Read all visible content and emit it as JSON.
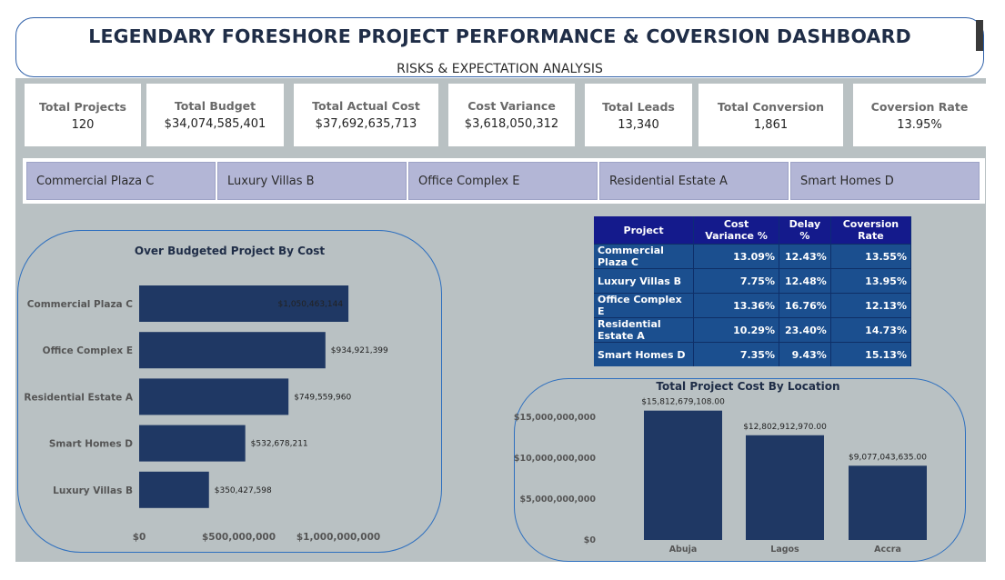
{
  "header": {
    "title": "LEGENDARY FORESHORE PROJECT PERFORMANCE & COVERSION DASHBOARD",
    "subtitle": "RISKS & EXPECTATION ANALYSIS"
  },
  "kpis": [
    {
      "label": "Total Projects",
      "value": "120"
    },
    {
      "label": "Total Budget",
      "value": "$34,074,585,401"
    },
    {
      "label": "Total Actual Cost",
      "value": "$37,692,635,713"
    },
    {
      "label": "Cost Variance",
      "value": "$3,618,050,312"
    },
    {
      "label": "Total Leads",
      "value": "13,340"
    },
    {
      "label": "Total Conversion",
      "value": "1,861"
    },
    {
      "label": "Coversion Rate",
      "value": "13.95%"
    }
  ],
  "slicers": [
    "Commercial Plaza C",
    "Luxury Villas B",
    "Office Complex E",
    "Residential Estate A",
    "Smart Homes D"
  ],
  "table": {
    "headers": [
      "Project",
      "Cost Variance %",
      "Delay %",
      "Coversion Rate"
    ],
    "rows": [
      [
        "Commercial Plaza C",
        "13.09%",
        "12.43%",
        "13.55%"
      ],
      [
        "Luxury Villas B",
        "7.75%",
        "12.48%",
        "13.95%"
      ],
      [
        "Office Complex E",
        "13.36%",
        "16.76%",
        "12.13%"
      ],
      [
        "Residential Estate A",
        "10.29%",
        "23.40%",
        "14.73%"
      ],
      [
        "Smart Homes D",
        "7.35%",
        "9.43%",
        "15.13%"
      ]
    ]
  },
  "colors": {
    "bar": "#1f3864",
    "canvas": "#b9c1c3",
    "slicer": "#b3b6d6",
    "table_header": "#141a8c",
    "table_body": "#1b4f8f"
  },
  "chart_data": [
    {
      "type": "bar",
      "orientation": "horizontal",
      "title": "Over Budgeted Project By Cost",
      "categories": [
        "Commercial Plaza C",
        "Office Complex E",
        "Residential Estate A",
        "Smart Homes D",
        "Luxury Villas B"
      ],
      "values": [
        1050463144,
        934921399,
        749559960,
        532678211,
        350427598
      ],
      "value_labels": [
        "$1,050,463,144",
        "$934,921,399",
        "$749,559,960",
        "$532,678,211",
        "$350,427,598"
      ],
      "xticks": [
        "$0",
        "$500,000,000",
        "$1,000,000,000"
      ],
      "xlim": [
        0,
        1050000000
      ],
      "grid": false
    },
    {
      "type": "bar",
      "title": "Total Project Cost By Location",
      "categories": [
        "Abuja",
        "Lagos",
        "Accra"
      ],
      "values": [
        15812679108,
        12802912970,
        9077043635
      ],
      "value_labels": [
        "$15,812,679,108.00",
        "$12,802,912,970.00",
        "$9,077,043,635.00"
      ],
      "yticks": [
        "$0",
        "$5,000,000,000",
        "$10,000,000,000",
        "$15,000,000,000"
      ],
      "ylim": [
        0,
        16000000000
      ],
      "grid": false
    }
  ]
}
